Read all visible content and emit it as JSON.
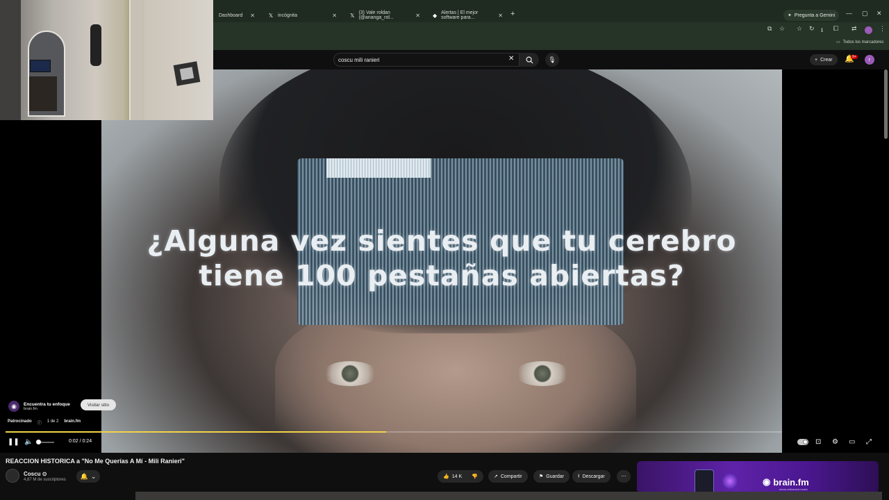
{
  "browser": {
    "tabs": [
      {
        "title": "Dashboard",
        "icon": "dashboard-icon"
      },
      {
        "title": "incógnita",
        "icon": "x-icon"
      },
      {
        "title": "(3) Vale roldan (@ananga_rol...",
        "icon": "x-icon"
      },
      {
        "title": "Alertas | El mejor software para...",
        "icon": "alert-icon"
      }
    ],
    "gemini_label": "Pregunta a Gemini",
    "bookmarks_label": "Todos los marcadores"
  },
  "youtube": {
    "search_query": "coscu mili ranieri",
    "create_label": "Crear",
    "notification_count": "9+",
    "avatar_initial": "r"
  },
  "video": {
    "caption_line1": "¿Alguna vez sientes que tu cerebro",
    "caption_line2": "tiene 100 pestañas abiertas?",
    "ad": {
      "title": "Encuentra tu enfoque",
      "domain": "brain.fm",
      "visit_label": "Visitar sitio",
      "sponsored_label": "Patrocinado",
      "ad_count": "1 de 2",
      "advertiser": "brain.fm"
    },
    "time": "0:02 / 0:24",
    "progress": 0.49,
    "volume": 0.2
  },
  "below": {
    "title": "REACCION HISTORICA a \"No Me Querías A Mí - Mili Ranieri\"",
    "channel": "Coscu",
    "verified": "⊙",
    "subscribers": "4,87 M de suscriptores",
    "likes": "14 K",
    "share_label": "Compartir",
    "save_label": "Guardar",
    "download_label": "Descargar"
  },
  "promo": {
    "brand": "brain.fm",
    "tagline": "neuro-enhanced music"
  },
  "colors": {
    "progress": "#f2d44a",
    "background": "#0f0f0f",
    "browser_frame": "#1f2a20",
    "promo": "#5e22a8"
  }
}
